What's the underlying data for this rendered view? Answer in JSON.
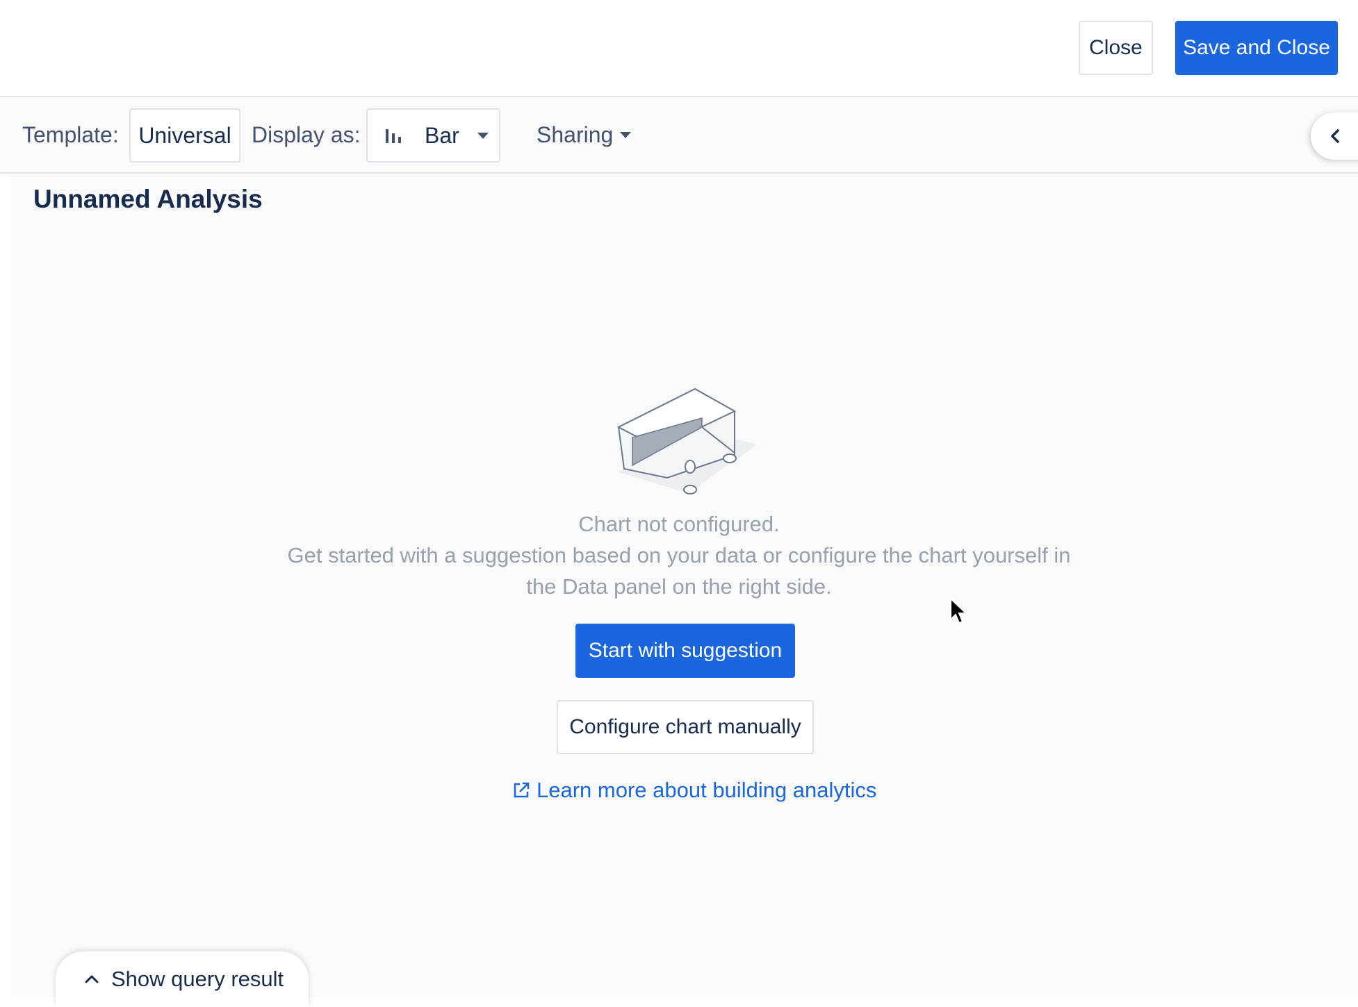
{
  "header": {
    "close_label": "Close",
    "save_close_label": "Save and Close"
  },
  "toolbar": {
    "template_label": "Template:",
    "template_value": "Universal",
    "display_label": "Display as:",
    "display_value": "Bar",
    "display_icon": "bar-chart-icon",
    "sharing_label": "Sharing"
  },
  "main": {
    "title": "Unnamed Analysis",
    "empty_state": {
      "title": "Chart not configured.",
      "line1": "Get started with a suggestion based on your data or configure the chart yourself in",
      "line2": "the Data panel on the right side.",
      "start_button": "Start with suggestion",
      "configure_button": "Configure chart manually",
      "learn_link": "Learn more about building analytics"
    }
  },
  "footer": {
    "query_tab_label": "Show query result"
  },
  "colors": {
    "primary": "#1a66df",
    "muted_text": "#97a0af",
    "text": "#172b4d"
  }
}
